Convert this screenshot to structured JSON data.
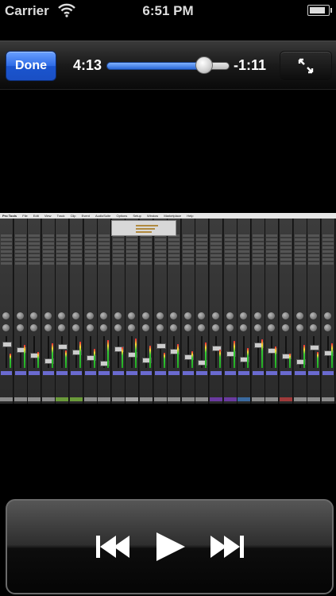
{
  "status_bar": {
    "carrier": "Carrier",
    "time": "6:51 PM",
    "wifi_icon": "wifi-icon",
    "battery_icon": "battery-icon",
    "battery_level": 0.85
  },
  "player": {
    "done_label": "Done",
    "elapsed": "4:13",
    "remaining": "-1:11",
    "progress": 0.79,
    "expand_icon": "expand-icon",
    "accent_color": "#2e6be6"
  },
  "video": {
    "menu_app": "Pro Tools",
    "menu_items": [
      "File",
      "Edit",
      "View",
      "Track",
      "Clip",
      "Event",
      "AudioSuite",
      "Options",
      "Setup",
      "Window",
      "Marketplace",
      "Help"
    ]
  },
  "transport": {
    "previous_icon": "skip-back-icon",
    "play_icon": "play-icon",
    "next_icon": "skip-forward-icon"
  }
}
